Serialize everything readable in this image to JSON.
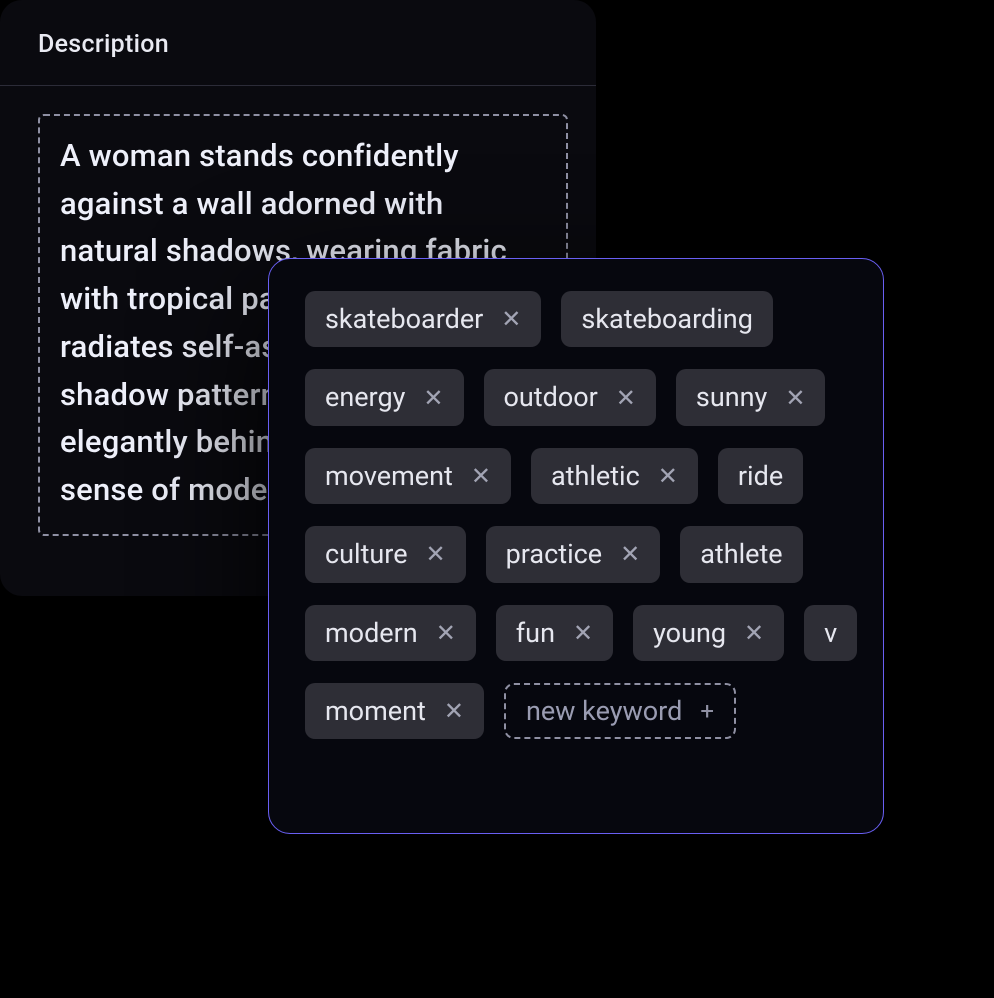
{
  "description": {
    "header": "Description",
    "text": "A woman stands confidently against a wall adorned with natural shadows, wearing fabric with tropical patterns. Her pose radiates self-assurance, while the shadow patterns contrast elegantly behind her, creating a sense of modern style."
  },
  "keywords": {
    "rows": [
      [
        {
          "label": "skateboarder",
          "remove": true
        },
        {
          "label": "skateboarding",
          "remove": false
        }
      ],
      [
        {
          "label": "energy",
          "remove": true
        },
        {
          "label": "outdoor",
          "remove": true
        },
        {
          "label": "sunny",
          "remove": true
        }
      ],
      [
        {
          "label": "movement",
          "remove": true
        },
        {
          "label": "athletic",
          "remove": true
        },
        {
          "label": "ride",
          "remove": false
        }
      ],
      [
        {
          "label": "culture",
          "remove": true
        },
        {
          "label": "practice",
          "remove": true
        },
        {
          "label": "athlete",
          "remove": false
        }
      ],
      [
        {
          "label": "modern",
          "remove": true
        },
        {
          "label": "fun",
          "remove": true
        },
        {
          "label": "young",
          "remove": true
        },
        {
          "label": "v",
          "remove": false
        }
      ],
      [
        {
          "label": "moment",
          "remove": true
        }
      ]
    ],
    "add_label": "new keyword"
  }
}
